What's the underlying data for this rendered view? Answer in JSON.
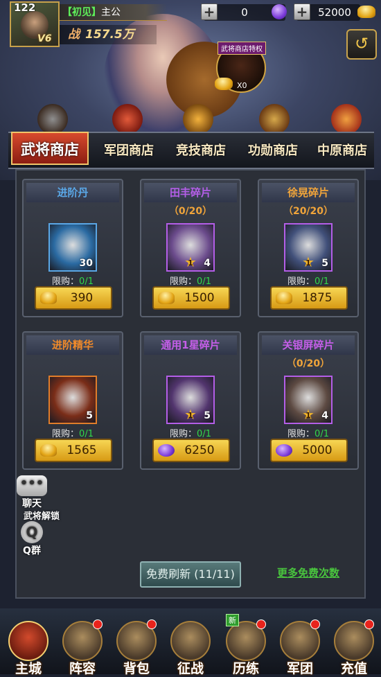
{
  "player": {
    "level": "122",
    "vip": "V6",
    "tag": "【初见】",
    "name": "主公",
    "power_label": "战",
    "power_value": "157.5万"
  },
  "resources": {
    "gems": "0",
    "gold": "52000"
  },
  "privilege": {
    "title": "武将商店特权",
    "count": "X0"
  },
  "tabs": [
    "武将商店",
    "军团商店",
    "竞技商店",
    "功勋商店",
    "中原商店"
  ],
  "shop": {
    "limit_label": "限购：",
    "items": [
      {
        "name": "进阶丹",
        "name_color": "#5aa7e6",
        "progress": "",
        "qty": "30",
        "star": "",
        "limit": "0/1",
        "price": "390",
        "currency": "gold",
        "border": "#5aa7e6",
        "bg": "#2a6aa2"
      },
      {
        "name": "田丰碎片",
        "name_color": "#b45ee8",
        "progress": "（0/20）",
        "qty": "4",
        "star": "1",
        "limit": "0/1",
        "price": "1500",
        "currency": "gold",
        "border": "#b45ee8",
        "bg": "#6b4b8c"
      },
      {
        "name": "徐晃碎片",
        "name_color": "#f0a43a",
        "progress": "（20/20）",
        "qty": "5",
        "star": "1",
        "limit": "0/1",
        "price": "1875",
        "currency": "gold",
        "border": "#b45ee8",
        "bg": "#41507a"
      },
      {
        "name": "进阶精华",
        "name_color": "#f08a2a",
        "progress": "",
        "qty": "5",
        "star": "",
        "limit": "0/1",
        "price": "1565",
        "currency": "gold",
        "border": "#e17d2a",
        "bg": "#7a2d18"
      },
      {
        "name": "通用1星碎片",
        "name_color": "#c45ee8",
        "progress": "",
        "qty": "5",
        "star": "1",
        "limit": "0/1",
        "price": "6250",
        "currency": "gem",
        "border": "#b45ee8",
        "bg": "#52356e"
      },
      {
        "name": "关银屏碎片",
        "name_color": "#c45ee8",
        "progress": "（0/20）",
        "qty": "4",
        "star": "1",
        "limit": "0/1",
        "price": "5000",
        "currency": "gem",
        "border": "#b45ee8",
        "bg": "#5d4a42"
      }
    ]
  },
  "side": {
    "chat": "聊天",
    "unlock": "武将解锁",
    "qq": "Q群"
  },
  "refresh_label": "免费刷新 (11/11)",
  "more_free_label": "更多免费次数",
  "nav": [
    {
      "label": "主城",
      "icon": "castle-icon",
      "dot": false,
      "new": false
    },
    {
      "label": "阵容",
      "icon": "helmet-icon",
      "dot": true,
      "new": false
    },
    {
      "label": "背包",
      "icon": "bag-icon",
      "dot": true,
      "new": false
    },
    {
      "label": "征战",
      "icon": "crossed-swords-icon",
      "dot": false,
      "new": false
    },
    {
      "label": "历练",
      "icon": "scroll-icon",
      "dot": true,
      "new": true
    },
    {
      "label": "军团",
      "icon": "legion-icon",
      "dot": true,
      "new": false
    },
    {
      "label": "充值",
      "icon": "treasure-icon",
      "dot": true,
      "new": false
    }
  ],
  "new_badge": "新",
  "colors": {
    "gold": "#e3a516",
    "gem": "#7a3ad8",
    "limit_value": "#32d84a",
    "tab_active": "#c4381f"
  }
}
